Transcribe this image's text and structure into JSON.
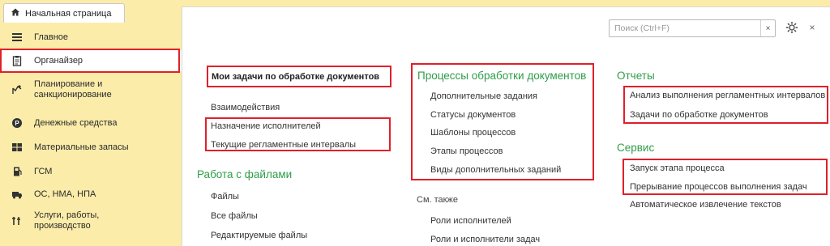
{
  "tab": {
    "home_label": "Начальная страница"
  },
  "sidebar": {
    "items": [
      {
        "label": "Главное"
      },
      {
        "label": "Органайзер"
      },
      {
        "label": "Планирование и санкционирование"
      },
      {
        "label": "Денежные средства"
      },
      {
        "label": "Материальные запасы"
      },
      {
        "label": "ГСМ"
      },
      {
        "label": "ОС, НМА, НПА"
      },
      {
        "label": "Услуги, работы, производство"
      }
    ]
  },
  "toolbar": {
    "search_placeholder": "Поиск (Ctrl+F)",
    "clear_label": "×",
    "close_label": "×"
  },
  "col1": {
    "top_link": "Мои задачи по обработке документов",
    "links": [
      "Взаимодействия",
      "Назначение исполнителей",
      "Текущие регламентные интервалы"
    ],
    "files_header": "Работа с файлами",
    "files_links": [
      "Файлы",
      "Все файлы",
      "Редактируемые файлы"
    ]
  },
  "col2": {
    "header": "Процессы обработки документов",
    "links": [
      "Дополнительные задания",
      "Статусы документов",
      "Шаблоны процессов",
      "Этапы процессов",
      "Виды дополнительных заданий"
    ],
    "see_also": "См. также",
    "see_also_links": [
      "Роли исполнителей",
      "Роли и исполнители задач"
    ]
  },
  "col3": {
    "reports_header": "Отчеты",
    "reports_links": [
      "Анализ выполнения регламентных интервалов",
      "Задачи по обработке документов"
    ],
    "service_header": "Сервис",
    "service_links": [
      "Запуск этапа процесса",
      "Прерывание процессов выполнения задач",
      "Автоматическое извлечение текстов"
    ]
  },
  "colors": {
    "accent_green": "#2f9d4a",
    "highlight_red": "#e0202a",
    "sidebar_bg": "#fbeca9"
  }
}
